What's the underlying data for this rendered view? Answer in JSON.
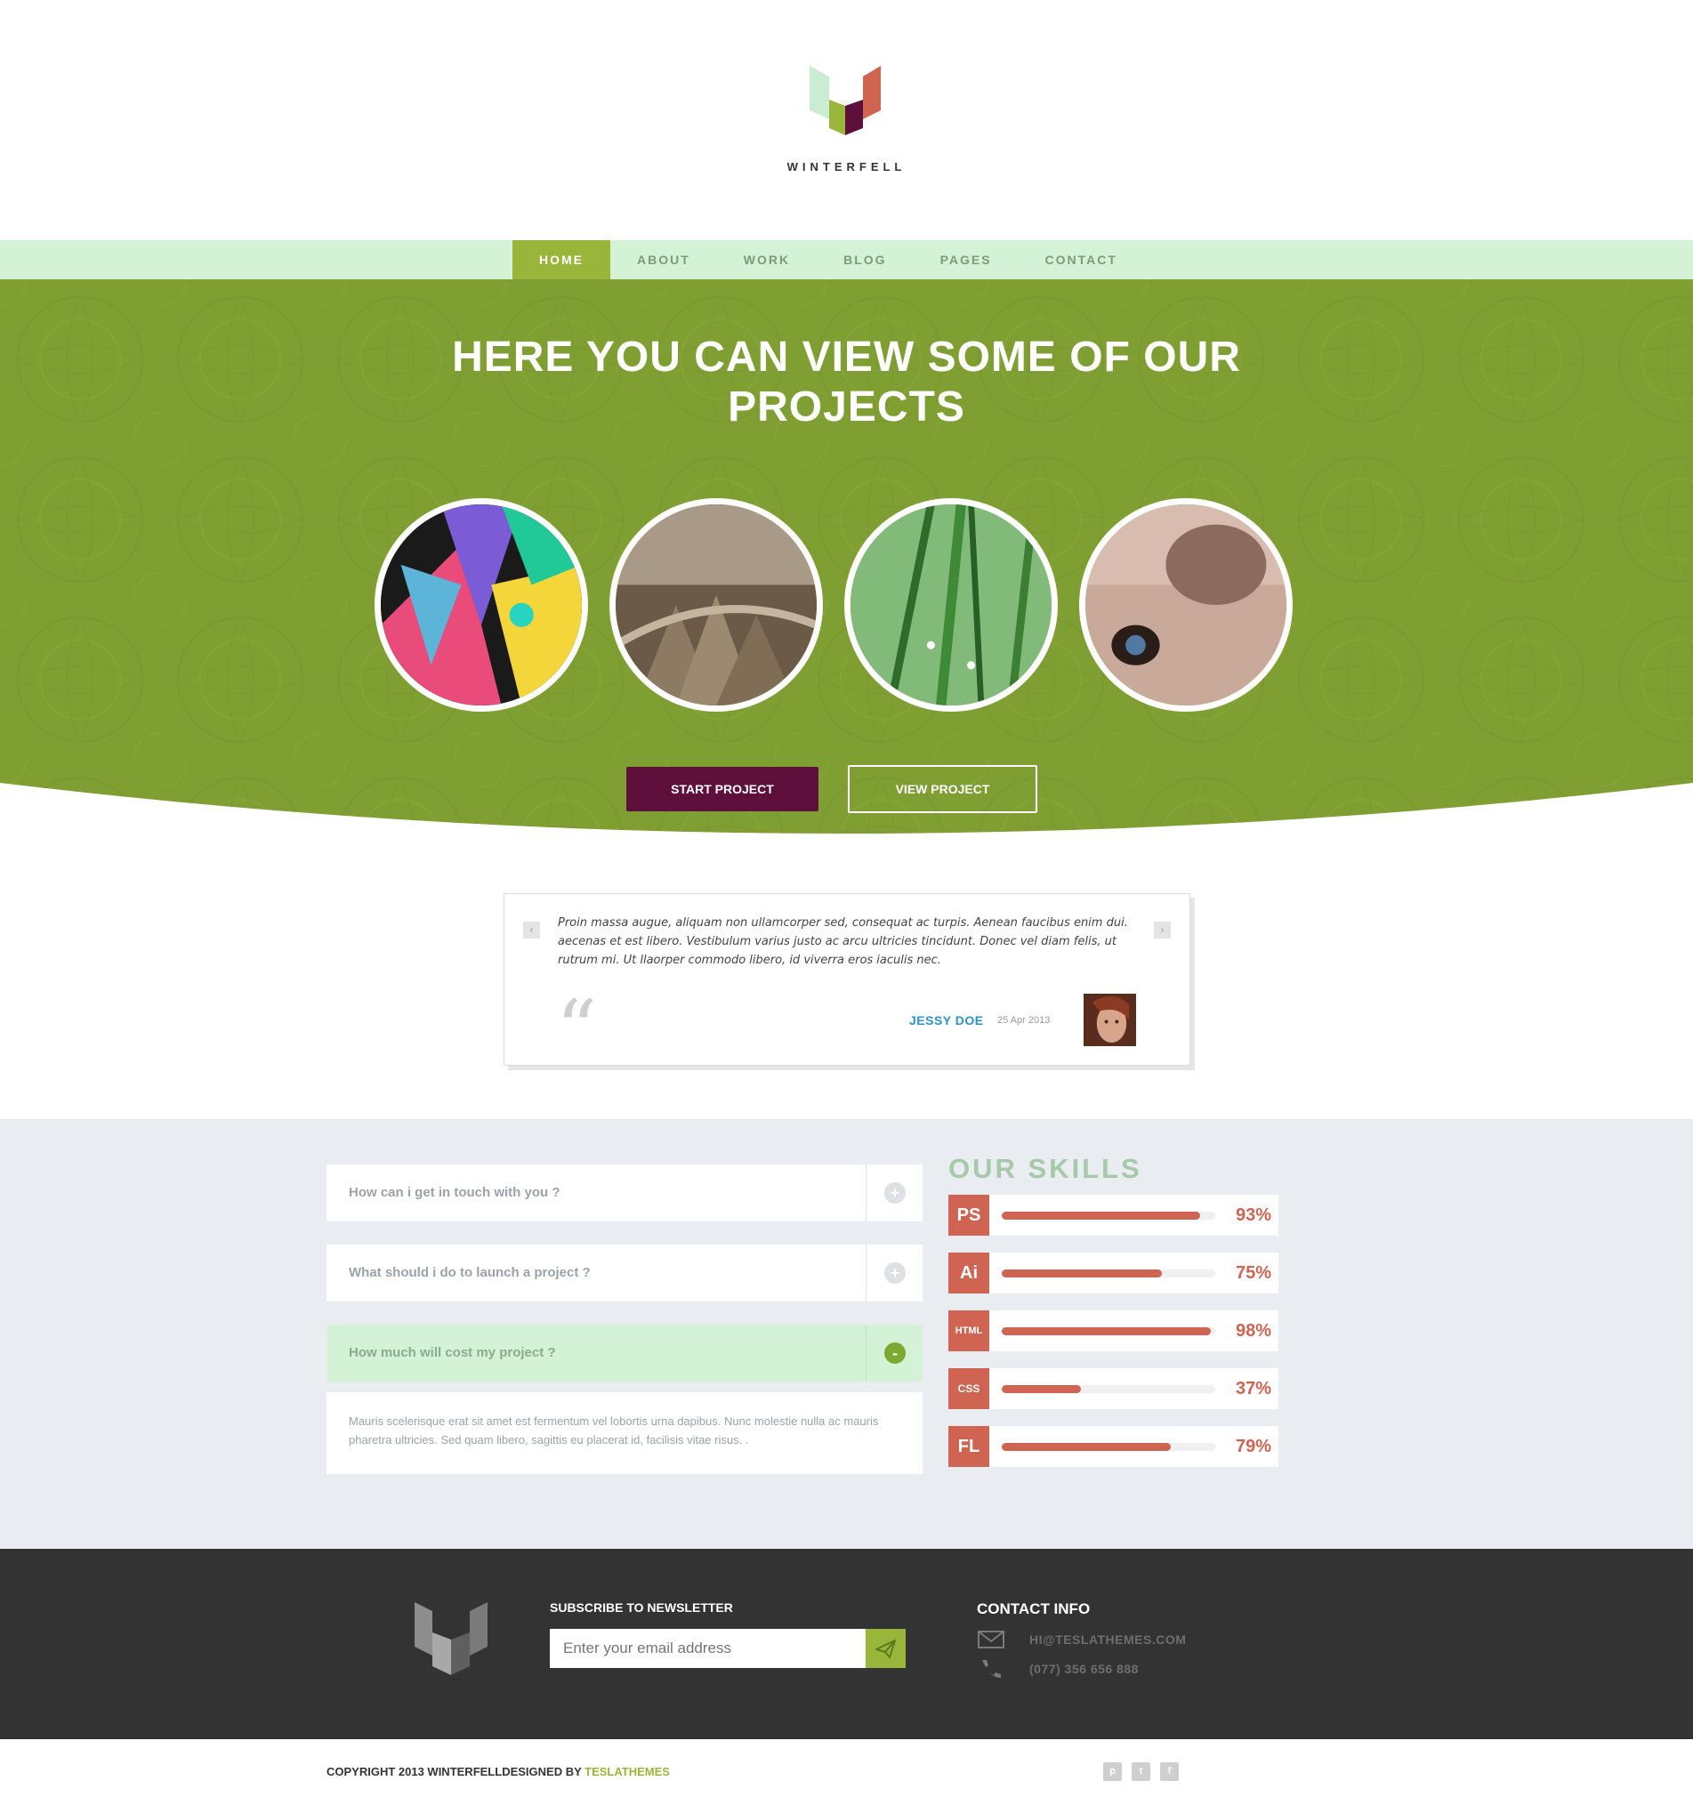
{
  "brand": {
    "name": "WINTERFELL"
  },
  "nav": {
    "items": [
      "HOME",
      "ABOUT",
      "WORK",
      "BLOG",
      "PAGES",
      "CONTACT"
    ],
    "active": "HOME"
  },
  "hero": {
    "title": "HERE YOU CAN VIEW SOME OF OUR PROJECTS",
    "start_label": "START PROJECT",
    "view_label": "VIEW PROJECT",
    "images": [
      "colorful-illustration",
      "dinosaur-scales",
      "green-grass",
      "dog-eye"
    ]
  },
  "testimonial": {
    "text": "Proin massa augue, aliquam non ullamcorper sed, consequat ac turpis. Aenean faucibus enim dui. aecenas et est libero. Vestibulum varius justo ac arcu ultricies tincidunt. Donec vel diam felis, ut rutrum mi. Ut llaorper commodo libero, id viverra eros iaculis nec.",
    "quote_mark": "“",
    "author": "JESSY DOE",
    "date": "25 Apr 2013",
    "prev": "‹",
    "next": "›"
  },
  "faq": {
    "items": [
      {
        "question": "How can i get in touch with you ?",
        "toggle": "+"
      },
      {
        "question": "What should i do to launch a project ?",
        "toggle": "+"
      },
      {
        "question": "How much will cost my project ?",
        "toggle": "-"
      }
    ],
    "answer": "Mauris scelerisque erat sit amet est fermentum vel lobortis urna dapibus. Nunc molestie nulla ac mauris pharetra ultricies. Sed quam libero, sagittis eu placerat id, facilisis vitae risus. ."
  },
  "skills": {
    "title": "OUR SKILLS",
    "items": [
      {
        "label": "PS",
        "percent": 93,
        "display": "93%"
      },
      {
        "label": "Ai",
        "percent": 75,
        "display": "75%"
      },
      {
        "label": "HTML",
        "percent": 98,
        "display": "98%"
      },
      {
        "label": "CSS",
        "percent": 37,
        "display": "37%"
      },
      {
        "label": "FL",
        "percent": 79,
        "display": "79%"
      }
    ]
  },
  "footer": {
    "newsletter_title": "SUBSCRIBE TO NEWSLETTER",
    "email_placeholder": "Enter your email address",
    "contact_title": "CONTACT INFO",
    "email": "HI@TESLATHEMES.COM",
    "phone": "(077) 356 656 888",
    "copyright_prefix": "COPYRIGHT 2013 WINTERFELLDESIGNED BY ",
    "copyright_brand": "TESLATHEMES",
    "social": [
      "p",
      "t",
      "f"
    ]
  },
  "colors": {
    "accent_green": "#99b63a",
    "hero_green": "#7f9f33",
    "nav_bg": "#d3f2d6",
    "plum": "#5e0f3b",
    "skill_red": "#d06452",
    "footer_dark": "#333333",
    "link_blue": "#2a93c9"
  }
}
